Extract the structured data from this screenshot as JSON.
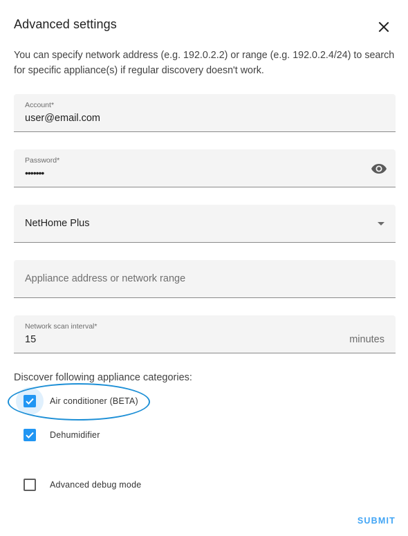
{
  "dialog": {
    "title": "Advanced settings",
    "close_icon": "close-icon",
    "description": "You can specify network address (e.g. 192.0.2.2) or range (e.g. 192.0.2.4/24) to search for specific appliance(s) if regular discovery doesn't work."
  },
  "fields": {
    "account": {
      "label": "Account*",
      "value": "user@email.com"
    },
    "password": {
      "label": "Password*",
      "masked_value": "•••••••",
      "icon": "eye-icon"
    },
    "app": {
      "selected": "NetHome Plus",
      "icon": "chevron-down-icon"
    },
    "address": {
      "placeholder": "Appliance address or network range"
    },
    "scan_interval": {
      "label": "Network scan interval*",
      "value": "15",
      "suffix": "minutes"
    }
  },
  "categories": {
    "label": "Discover following appliance categories:",
    "items": [
      {
        "label": "Air conditioner (BETA)",
        "checked": true
      },
      {
        "label": "Dehumidifier",
        "checked": true
      }
    ]
  },
  "debug": {
    "label": "Advanced debug mode",
    "checked": false
  },
  "actions": {
    "submit_label": "SUBMIT"
  },
  "colors": {
    "accent": "#2196f3",
    "annotation": "#1d8fd6"
  }
}
